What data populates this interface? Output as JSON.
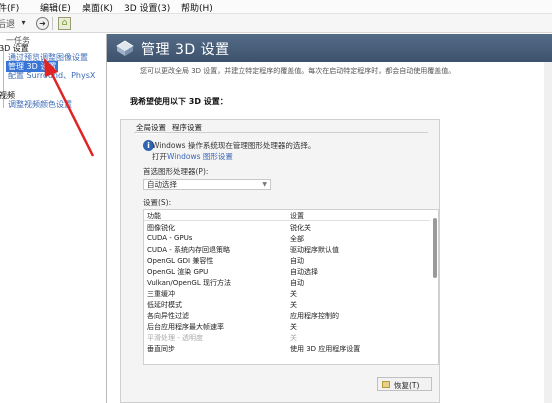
{
  "menubar": {
    "items": [
      "件(F)",
      "编辑(E)",
      "桌面(K)",
      "3D 设置(3)",
      "帮助(H)"
    ]
  },
  "toolbar": {
    "back_label": "后退",
    "forward_icon": "arrow-right-icon",
    "home_icon": "home-icon"
  },
  "sidebar": {
    "head": "一任务",
    "items": [
      {
        "label": "3D 设置",
        "kind": "cat"
      },
      {
        "label": "通过预览调整图像设置",
        "kind": "link"
      },
      {
        "label": "管理 3D 设置",
        "kind": "selected"
      },
      {
        "label": "配置 Surround、PhysX",
        "kind": "link"
      },
      {
        "label": "视频",
        "kind": "cat"
      },
      {
        "label": "调整视频颜色设置",
        "kind": "link"
      }
    ]
  },
  "header": {
    "title": "管理 3D 设置"
  },
  "description": "您可以更改全局 3D 设置，并建立特定程序的覆盖值。每次在启动特定程序时，都会自动使用覆盖值。",
  "section_label": "我希望使用以下 3D 设置：",
  "tabs": [
    "全局设置",
    "程序设置"
  ],
  "info": {
    "line1": "Windows 操作系统现在管理图形处理器的选择。",
    "line2_prefix": "打开",
    "line2_link": "Windows 图形设置"
  },
  "preferred_gpu": {
    "label": "首选图形处理器(P):",
    "value": "自动选择"
  },
  "settings_label": "设置(S):",
  "settings_table": {
    "headers": [
      "功能",
      "设置"
    ],
    "rows": [
      {
        "feature": "图像锐化",
        "value": "锐化关",
        "dim": false
      },
      {
        "feature": "CUDA - GPUs",
        "value": "全部",
        "dim": false
      },
      {
        "feature": "CUDA - 系统内存回退策略",
        "value": "驱动程序默认值",
        "dim": false
      },
      {
        "feature": "OpenGL GDI 兼容性",
        "value": "自动",
        "dim": false
      },
      {
        "feature": "OpenGL 渲染 GPU",
        "value": "自动选择",
        "dim": false
      },
      {
        "feature": "Vulkan/OpenGL 现行方法",
        "value": "自动",
        "dim": false
      },
      {
        "feature": "三重缓冲",
        "value": "关",
        "dim": false
      },
      {
        "feature": "低延时模式",
        "value": "关",
        "dim": false
      },
      {
        "feature": "各向异性过滤",
        "value": "应用程序控制的",
        "dim": false
      },
      {
        "feature": "后台应用程序最大帧速率",
        "value": "关",
        "dim": false
      },
      {
        "feature": "平滑处理 - 透明度",
        "value": "关",
        "dim": true
      },
      {
        "feature": "垂直同步",
        "value": "使用 3D 应用程序设置",
        "dim": false
      }
    ]
  },
  "restore_button": "恢复(T)",
  "colors": {
    "header_bg": "#4a5f7a",
    "link": "#3a69b7",
    "selection": "#3875d7",
    "arrow": "#e02424"
  }
}
